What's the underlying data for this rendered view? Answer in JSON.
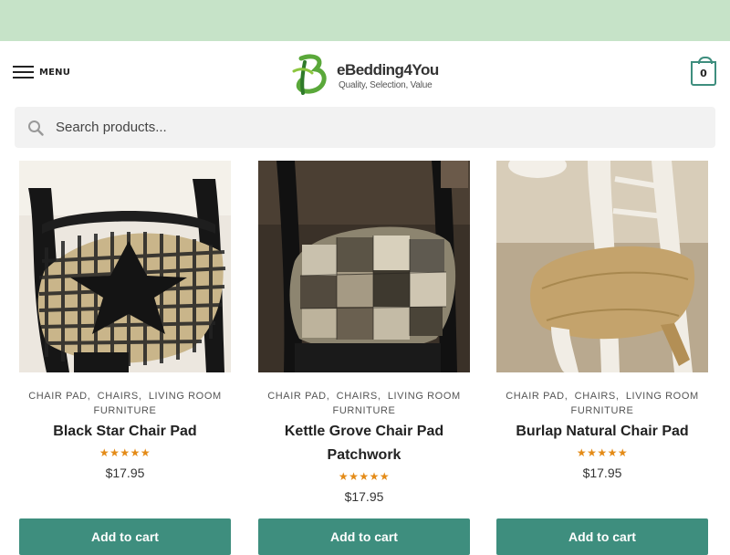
{
  "header": {
    "menu_label": "MENU",
    "logo_name": "eBedding4You",
    "logo_tagline": "Quality, Selection, Value",
    "cart_count": "0",
    "icons": {
      "menu": "hamburger-icon",
      "cart": "shopping-bag-icon",
      "search": "search-icon"
    }
  },
  "search": {
    "placeholder": "Search products..."
  },
  "colors": {
    "topbar": "#c6e3c8",
    "accent": "#3e8e7e",
    "star": "#e48b17"
  },
  "products": [
    {
      "categories": [
        "CHAIR PAD",
        "CHAIRS",
        "LIVING ROOM FURNITURE"
      ],
      "title": "Black Star Chair Pad",
      "rating": 4.5,
      "stars": "★★★★★",
      "price": "$17.95",
      "button": "Add to cart"
    },
    {
      "categories": [
        "CHAIR PAD",
        "CHAIRS",
        "LIVING ROOM FURNITURE"
      ],
      "title": "Kettle Grove Chair Pad Patchwork",
      "rating": 4.5,
      "stars": "★★★★★",
      "price": "$17.95",
      "button": "Add to cart"
    },
    {
      "categories": [
        "CHAIR PAD",
        "CHAIRS",
        "LIVING ROOM FURNITURE"
      ],
      "title": "Burlap Natural Chair Pad",
      "rating": 5,
      "stars": "★★★★★",
      "price": "$17.95",
      "button": "Add to cart"
    }
  ]
}
